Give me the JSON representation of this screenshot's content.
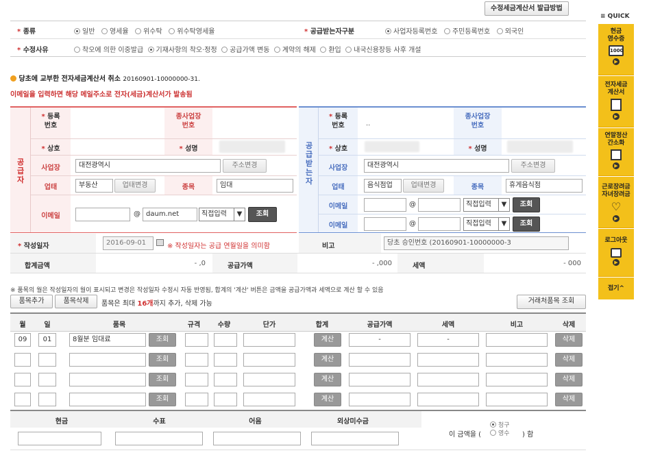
{
  "top_button": "수정세금계산서 발급방법",
  "form_type": {
    "label": "종류",
    "options": [
      "일반",
      "영세율",
      "위수탁",
      "위수탁영세율"
    ],
    "selected": 0
  },
  "receiver_type": {
    "label": "공급받는자구분",
    "options": [
      "사업자등록번호",
      "주민등록번호",
      "외국인"
    ],
    "selected": 0
  },
  "reason": {
    "label": "수정사유",
    "options": [
      "착오에 의한 이중발급",
      "기재사항의 착오·정정",
      "공급가액 변동",
      "계약의 해제",
      "환입",
      "내국신용장등 사후 개설"
    ],
    "selected": 1
  },
  "cancel_notice": {
    "title": "당초에 교부한 전자세금계산서 취소",
    "number": "20160901-10000000-31."
  },
  "email_notice": "이메일을 입력하면 해당 메일주소로 전자(세금)계산서가 발송됨",
  "supplier": {
    "side_label": "공급자",
    "reg_label": "등록\n번호",
    "sub_label": "종사업장\n번호",
    "name_label": "상호",
    "rep_label": "성명",
    "addr_label": "사업장",
    "addr_value": "대전광역시 ",
    "addr_btn": "주소변경",
    "biz_label": "업태",
    "biz_value": "부동산",
    "biz_btn": "업태변경",
    "item_label": "종목",
    "item_value": "임대",
    "email_label": "이메일",
    "email_domain": "daum.net",
    "email_select": "직접입력",
    "lookup_btn": "조회"
  },
  "receiver": {
    "side_label": "공급받는자",
    "reg_label": "등록\n번호",
    "reg_value": "..",
    "sub_label": "종사업장\n번호",
    "name_label": "상호",
    "rep_label": "성명",
    "addr_label": "사업장",
    "addr_value": "대전광역시 ",
    "addr_btn": "주소변경",
    "biz_label": "업태",
    "biz_value": "음식점업",
    "biz_btn": "업태변경",
    "item_label": "종목",
    "item_value": "휴게음식점",
    "email_label": "이메일",
    "email_label2": "이메일",
    "email_select": "직접입력",
    "lookup_btn": "조회"
  },
  "write_date": {
    "label": "작성일자",
    "value": "2016-09-01",
    "note": "※ 작성일자는 공급 연월일을 의미함"
  },
  "remark": {
    "label": "비고",
    "value": "당초 승인번호 (20160901-10000000-3"
  },
  "totals": {
    "total_label": "합계금액",
    "total_value": "- ,0",
    "supply_label": "공급가액",
    "supply_value": "- ,000",
    "tax_label": "세액",
    "tax_value": "- 000"
  },
  "items_note": "※ 품목의 월은 작성일자의 월이 표시되고 변경은 작성일자 수정시 자동 반영됨, 합계의 '계산' 버튼은 금액을 공급가액과 세액으로 계산 할 수 있음",
  "items_toolbar": {
    "add": "품목추가",
    "delete": "품목삭제",
    "limit_prefix": "품목은 최대 ",
    "limit_count": "16개",
    "limit_suffix": "까지 추가, 삭제 가능",
    "partner_btn": "거래처품목 조회"
  },
  "item_headers": [
    "월",
    "일",
    "품목",
    "규격",
    "수량",
    "단가",
    "합계",
    "공급가액",
    "세액",
    "비고",
    "삭제"
  ],
  "item_rows": [
    {
      "month": "09",
      "day": "01",
      "name": "8월분 임대료",
      "supply": "-",
      "tax": "-"
    },
    {
      "month": "",
      "day": "",
      "name": "",
      "supply": "",
      "tax": ""
    },
    {
      "month": "",
      "day": "",
      "name": "",
      "supply": "",
      "tax": ""
    },
    {
      "month": "",
      "day": "",
      "name": "",
      "supply": "",
      "tax": ""
    }
  ],
  "row_buttons": {
    "lookup": "조회",
    "calc": "계산",
    "delete": "삭제"
  },
  "payment": {
    "headers": [
      "현금",
      "수표",
      "어음",
      "외상미수금"
    ],
    "claim_prefix": "이 금액을 (",
    "claim_opt1": "청구",
    "claim_opt2": "영수",
    "claim_suffix": ") 함"
  },
  "sidebar": {
    "quick": "≡ QUICK",
    "items": [
      {
        "label": "현금\n영수증"
      },
      {
        "label": "전자세금\n계산서"
      },
      {
        "label": "연말정산\n간소화"
      },
      {
        "label": "근로장려금\n자녀장려금"
      },
      {
        "label": "로그아웃"
      }
    ],
    "collapse": "접기^"
  },
  "colors": {
    "supplier_accent": "#e06060",
    "receiver_accent": "#6a8ed0",
    "star_red": "#d03030",
    "sidebar_yellow": "#f3c01a"
  }
}
